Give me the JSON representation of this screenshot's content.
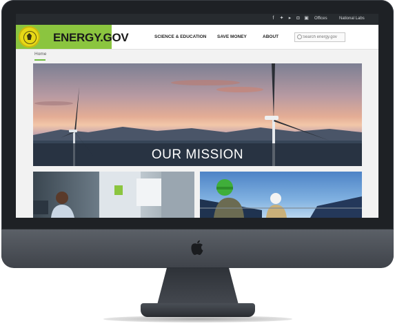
{
  "utility_bar": {
    "social_icons": [
      "facebook-icon",
      "twitter-icon",
      "youtube-icon",
      "instagram-icon",
      "linkedin-icon"
    ],
    "links": [
      "Offices",
      "National Labs"
    ]
  },
  "header": {
    "site_name": "ENERGY.GOV",
    "nav": [
      "SCIENCE & EDUCATION",
      "SAVE MONEY",
      "ABOUT"
    ],
    "search_placeholder": "Search energy.gov"
  },
  "breadcrumb": "Home",
  "hero": {
    "title": "OUR MISSION"
  },
  "colors": {
    "brand_green": "#8bc53f",
    "seal_yellow": "#e7d816",
    "utility_bar": "#272b2f",
    "accent_green": "#6dbb3f"
  }
}
